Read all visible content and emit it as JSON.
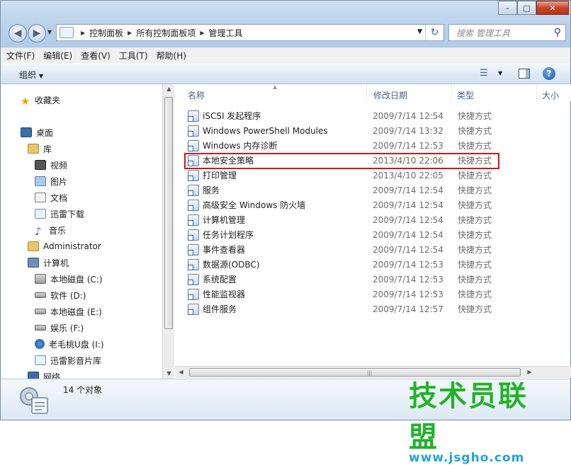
{
  "address": {
    "breadcrumbs": [
      "控制面板",
      "所有控制面板项",
      "管理工具"
    ]
  },
  "search": {
    "placeholder": "搜索 管理工具"
  },
  "menu": [
    "文件(F)",
    "编辑(E)",
    "查看(V)",
    "工具(T)",
    "帮助(H)"
  ],
  "toolbar": {
    "organize": "组织"
  },
  "nav": {
    "favorites": "收藏夹",
    "desktop": "桌面",
    "libraries": "库",
    "library_items": [
      "视频",
      "图片",
      "文档",
      "迅雷下载",
      "音乐"
    ],
    "user": "Administrator",
    "computer": "计算机",
    "drives": [
      "本地磁盘 (C:)",
      "软件 (D:)",
      "本地磁盘 (E:)",
      "娱乐 (F:)",
      "老毛桃U盘 (I:)",
      "迅雷影音片库"
    ],
    "network": "网络"
  },
  "columns": {
    "name": "名称",
    "date": "修改日期",
    "type": "类型",
    "size": "大小"
  },
  "files": [
    {
      "name": "iSCSI 发起程序",
      "date": "2009/7/14 12:54",
      "type": "快捷方式"
    },
    {
      "name": "Windows PowerShell Modules",
      "date": "2009/7/14 13:32",
      "type": "快捷方式"
    },
    {
      "name": "Windows 内存诊断",
      "date": "2009/7/14 12:53",
      "type": "快捷方式"
    },
    {
      "name": "本地安全策略",
      "date": "2013/4/10 22:06",
      "type": "快捷方式"
    },
    {
      "name": "打印管理",
      "date": "2013/4/10 22:05",
      "type": "快捷方式"
    },
    {
      "name": "服务",
      "date": "2009/7/14 12:54",
      "type": "快捷方式"
    },
    {
      "name": "高级安全 Windows 防火墙",
      "date": "2009/7/14 12:54",
      "type": "快捷方式"
    },
    {
      "name": "计算机管理",
      "date": "2009/7/14 12:54",
      "type": "快捷方式"
    },
    {
      "name": "任务计划程序",
      "date": "2009/7/14 12:54",
      "type": "快捷方式"
    },
    {
      "name": "事件查看器",
      "date": "2009/7/14 12:54",
      "type": "快捷方式"
    },
    {
      "name": "数据源(ODBC)",
      "date": "2009/7/14 12:53",
      "type": "快捷方式"
    },
    {
      "name": "系统配置",
      "date": "2009/7/14 12:53",
      "type": "快捷方式"
    },
    {
      "name": "性能监视器",
      "date": "2009/7/14 12:53",
      "type": "快捷方式"
    },
    {
      "name": "组件服务",
      "date": "2009/7/14 12:57",
      "type": "快捷方式"
    }
  ],
  "status": {
    "count": "14 个对象"
  },
  "watermark": {
    "title": "技术员联盟",
    "url": "www.jsgho.com"
  }
}
